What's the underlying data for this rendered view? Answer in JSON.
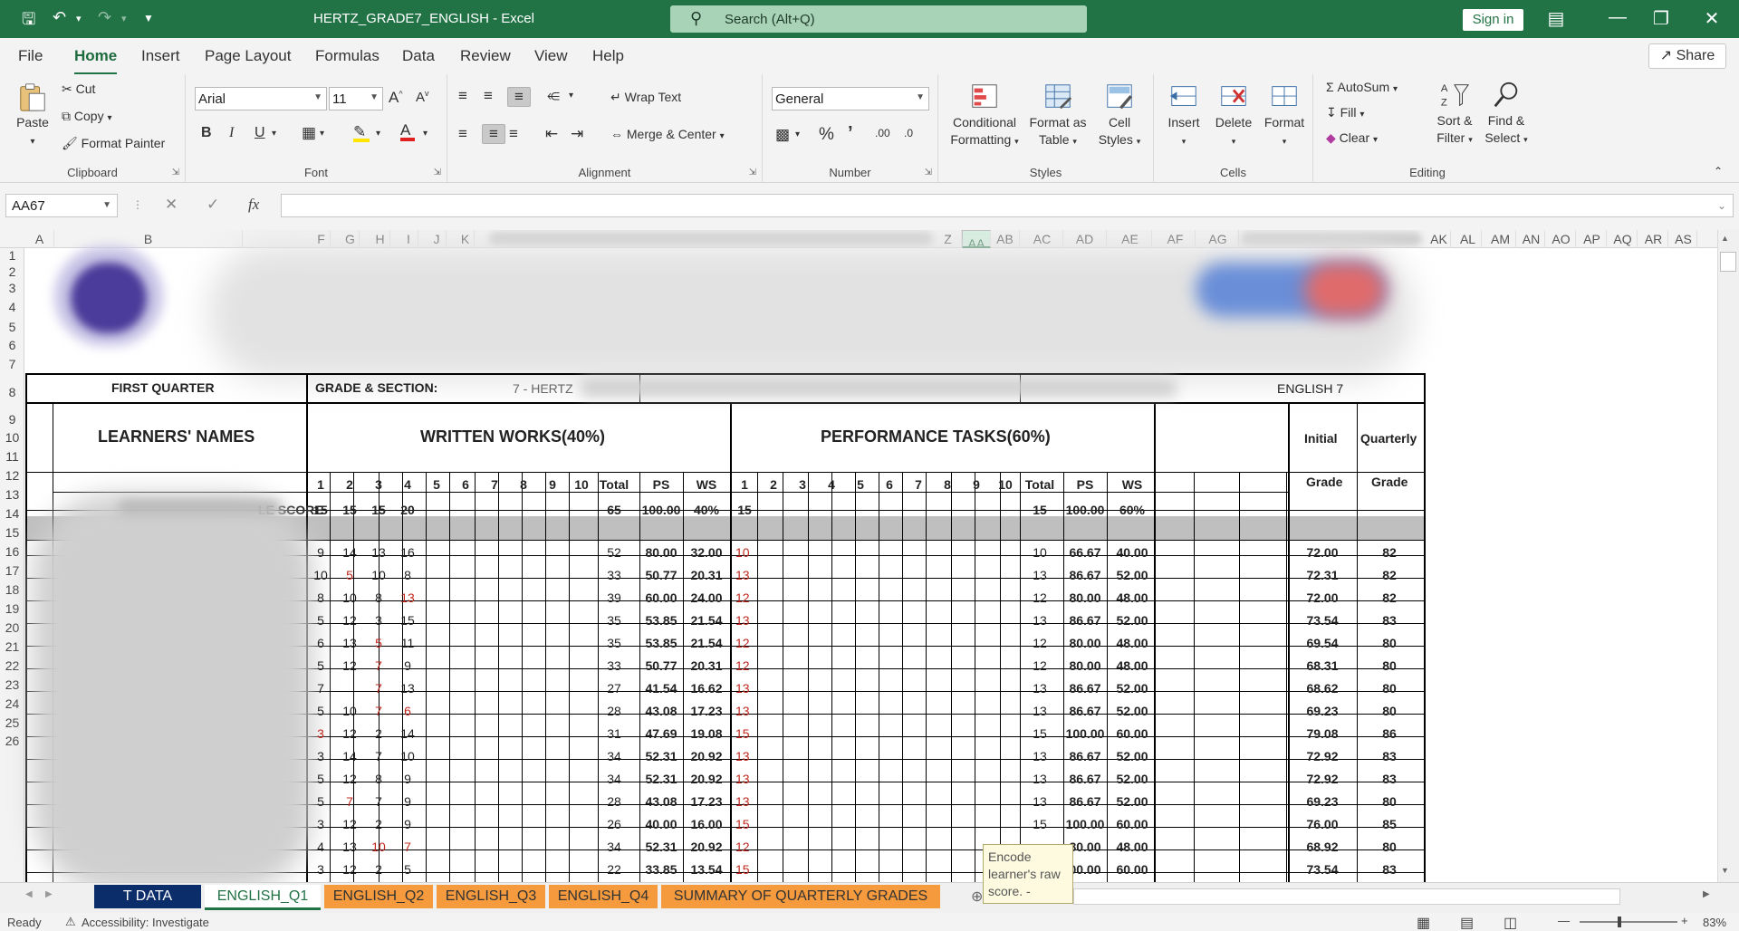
{
  "window": {
    "title": "HERTZ_GRADE7_ENGLISH  -  Excel",
    "search_placeholder": "Search (Alt+Q)",
    "signin": "Sign in"
  },
  "menu": {
    "tabs": [
      "File",
      "Home",
      "Insert",
      "Page Layout",
      "Formulas",
      "Data",
      "Review",
      "View",
      "Help"
    ],
    "share": "Share"
  },
  "ribbon": {
    "clipboard": {
      "label": "Clipboard",
      "paste": "Paste",
      "cut": "Cut",
      "copy": "Copy",
      "format_painter": "Format Painter"
    },
    "font": {
      "label": "Font",
      "name": "Arial",
      "size": "11"
    },
    "alignment": {
      "label": "Alignment",
      "wrap": "Wrap Text",
      "merge": "Merge & Center"
    },
    "number": {
      "label": "Number",
      "format": "General"
    },
    "styles": {
      "label": "Styles",
      "cond1": "Conditional",
      "cond2": "Formatting",
      "fmt1": "Format as",
      "fmt2": "Table",
      "cell1": "Cell",
      "cell2": "Styles"
    },
    "cells": {
      "label": "Cells",
      "insert": "Insert",
      "delete": "Delete",
      "format": "Format"
    },
    "editing": {
      "label": "Editing",
      "autosum": "AutoSum",
      "fill": "Fill",
      "clear": "Clear",
      "sort1": "Sort &",
      "sort2": "Filter",
      "find1": "Find &",
      "find2": "Select"
    }
  },
  "formula_bar": {
    "name_box": "AA67",
    "fx": "fx"
  },
  "columns": [
    "A",
    "B",
    "F",
    "G",
    "H",
    "I",
    "J",
    "K",
    "Z",
    "AA",
    "AB",
    "AC",
    "AD",
    "AE",
    "AF",
    "AG",
    "AK",
    "AL",
    "AM",
    "AN",
    "AO",
    "AP",
    "AQ",
    "AR",
    "AS"
  ],
  "rows": [
    "1",
    "2",
    "3",
    "4",
    "5",
    "6",
    "7",
    "8",
    "9",
    "10",
    "11",
    "12",
    "13",
    "14",
    "15",
    "16",
    "17",
    "18",
    "19",
    "20",
    "21",
    "22",
    "23",
    "24",
    "25",
    "26"
  ],
  "sheet": {
    "quarter": "FIRST QUARTER",
    "grade_section_label": "GRADE & SECTION:",
    "grade_section_value": "7 - HERTZ",
    "subject": "ENGLISH 7",
    "learners": "LEARNERS' NAMES",
    "written": "WRITTEN WORKS(40%)",
    "performance": "PERFORMANCE TASKS(60%)",
    "initial": "Initial",
    "quarterly": "Quarterly",
    "grade": "Grade",
    "ww_headers": [
      "1",
      "2",
      "3",
      "4",
      "5",
      "6",
      "7",
      "8",
      "9",
      "10",
      "Total",
      "PS",
      "WS"
    ],
    "pt_headers": [
      "1",
      "2",
      "3",
      "4",
      "5",
      "6",
      "7",
      "8",
      "9",
      "10",
      "Total",
      "PS",
      "WS"
    ],
    "hps_label": "LE SCORE",
    "hps_ww": [
      "15",
      "15",
      "15",
      "20",
      "",
      "",
      "",
      "",
      "",
      "",
      "65",
      "100.00",
      "40%"
    ],
    "hps_pt": [
      "15",
      "",
      "",
      "",
      "",
      "",
      "",
      "",
      "",
      "",
      "15",
      "100.00",
      "60%"
    ],
    "data_rows": [
      {
        "ww": [
          "9",
          "14",
          "13",
          "16"
        ],
        "red": [],
        "wt": "52",
        "wps": "80.00",
        "wws": "32.00",
        "pt1": "10",
        "pt1red": true,
        "pt": "10",
        "pps": "66.67",
        "pws": "40.00",
        "init": "72.00",
        "q": "82"
      },
      {
        "ww": [
          "10",
          "5",
          "10",
          "8"
        ],
        "red": [
          1
        ],
        "wt": "33",
        "wps": "50.77",
        "wws": "20.31",
        "pt1": "13",
        "pt1red": true,
        "pt": "13",
        "pps": "86.67",
        "pws": "52.00",
        "init": "72.31",
        "q": "82"
      },
      {
        "ww": [
          "8",
          "10",
          "8",
          "13"
        ],
        "red": [
          3
        ],
        "wt": "39",
        "wps": "60.00",
        "wws": "24.00",
        "pt1": "12",
        "pt1red": true,
        "pt": "12",
        "pps": "80.00",
        "pws": "48.00",
        "init": "72.00",
        "q": "82"
      },
      {
        "ww": [
          "5",
          "12",
          "3",
          "15"
        ],
        "red": [],
        "wt": "35",
        "wps": "53.85",
        "wws": "21.54",
        "pt1": "13",
        "pt1red": true,
        "pt": "13",
        "pps": "86.67",
        "pws": "52.00",
        "init": "73.54",
        "q": "83"
      },
      {
        "ww": [
          "6",
          "13",
          "5",
          "11"
        ],
        "red": [
          2
        ],
        "wt": "35",
        "wps": "53.85",
        "wws": "21.54",
        "pt1": "12",
        "pt1red": true,
        "pt": "12",
        "pps": "80.00",
        "pws": "48.00",
        "init": "69.54",
        "q": "80"
      },
      {
        "ww": [
          "5",
          "12",
          "7",
          "9"
        ],
        "red": [
          2
        ],
        "wt": "33",
        "wps": "50.77",
        "wws": "20.31",
        "pt1": "12",
        "pt1red": true,
        "pt": "12",
        "pps": "80.00",
        "pws": "48.00",
        "init": "68.31",
        "q": "80"
      },
      {
        "ww": [
          "7",
          "",
          "7",
          "13"
        ],
        "red": [
          2
        ],
        "wt": "27",
        "wps": "41.54",
        "wws": "16.62",
        "pt1": "13",
        "pt1red": true,
        "pt": "13",
        "pps": "86.67",
        "pws": "52.00",
        "init": "68.62",
        "q": "80"
      },
      {
        "ww": [
          "5",
          "10",
          "7",
          "6"
        ],
        "red": [
          2,
          3
        ],
        "wt": "28",
        "wps": "43.08",
        "wws": "17.23",
        "pt1": "13",
        "pt1red": true,
        "pt": "13",
        "pps": "86.67",
        "pws": "52.00",
        "init": "69.23",
        "q": "80"
      },
      {
        "ww": [
          "3",
          "12",
          "2",
          "14"
        ],
        "red": [
          0
        ],
        "wt": "31",
        "wps": "47.69",
        "wws": "19.08",
        "pt1": "15",
        "pt1red": true,
        "pt": "15",
        "pps": "100.00",
        "pws": "60.00",
        "init": "79.08",
        "q": "86"
      },
      {
        "ww": [
          "3",
          "14",
          "7",
          "10"
        ],
        "red": [],
        "wt": "34",
        "wps": "52.31",
        "wws": "20.92",
        "pt1": "13",
        "pt1red": true,
        "pt": "13",
        "pps": "86.67",
        "pws": "52.00",
        "init": "72.92",
        "q": "83"
      },
      {
        "ww": [
          "5",
          "12",
          "8",
          "9"
        ],
        "red": [],
        "wt": "34",
        "wps": "52.31",
        "wws": "20.92",
        "pt1": "13",
        "pt1red": true,
        "pt": "13",
        "pps": "86.67",
        "pws": "52.00",
        "init": "72.92",
        "q": "83"
      },
      {
        "ww": [
          "5",
          "7",
          "7",
          "9"
        ],
        "red": [
          1
        ],
        "wt": "28",
        "wps": "43.08",
        "wws": "17.23",
        "pt1": "13",
        "pt1red": true,
        "pt": "13",
        "pps": "86.67",
        "pws": "52.00",
        "init": "69.23",
        "q": "80"
      },
      {
        "ww": [
          "3",
          "12",
          "2",
          "9"
        ],
        "red": [],
        "wt": "26",
        "wps": "40.00",
        "wws": "16.00",
        "pt1": "15",
        "pt1red": true,
        "pt": "15",
        "pps": "100.00",
        "pws": "60.00",
        "init": "76.00",
        "q": "85"
      },
      {
        "ww": [
          "4",
          "13",
          "10",
          "7"
        ],
        "red": [
          2,
          3
        ],
        "wt": "34",
        "wps": "52.31",
        "wws": "20.92",
        "pt1": "12",
        "pt1red": true,
        "pt": "",
        "pps": "80.00",
        "pws": "48.00",
        "init": "68.92",
        "q": "80"
      },
      {
        "ww": [
          "3",
          "12",
          "2",
          "5"
        ],
        "red": [],
        "wt": "22",
        "wps": "33.85",
        "wws": "13.54",
        "pt1": "15",
        "pt1red": true,
        "pt": "",
        "pps": "00.00",
        "pws": "60.00",
        "init": "73.54",
        "q": "83"
      }
    ]
  },
  "sheet_tabs": [
    "T DATA",
    "ENGLISH_Q1",
    "ENGLISH_Q2",
    "ENGLISH_Q3",
    "ENGLISH_Q4",
    "SUMMARY OF QUARTERLY GRADES"
  ],
  "tooltip": {
    "line1": "Encode",
    "line2": "learner's raw",
    "line3": "score. -"
  },
  "status": {
    "ready": "Ready",
    "accessibility": "Accessibility: Investigate",
    "zoom": "83%"
  }
}
